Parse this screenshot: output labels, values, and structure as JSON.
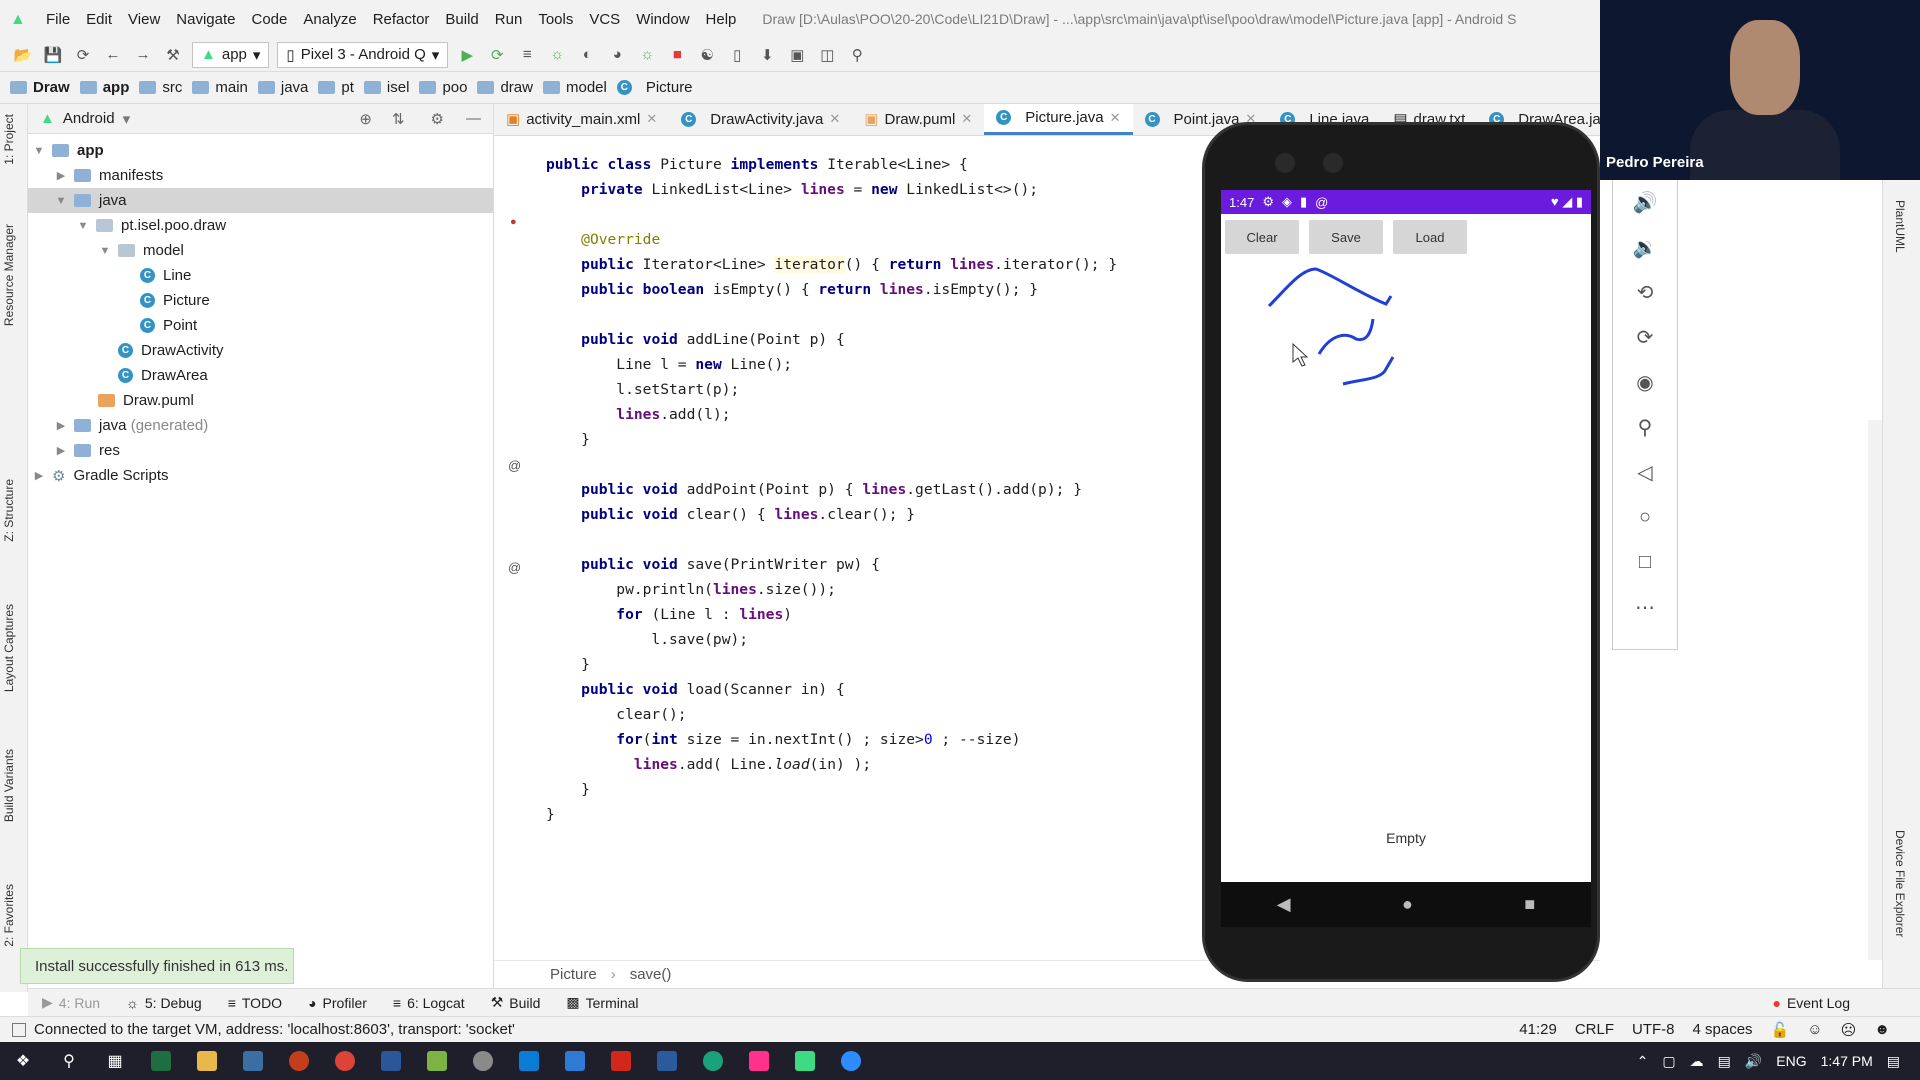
{
  "menu": {
    "items": [
      "File",
      "Edit",
      "View",
      "Navigate",
      "Code",
      "Analyze",
      "Refactor",
      "Build",
      "Run",
      "Tools",
      "VCS",
      "Window",
      "Help"
    ],
    "title": "Draw [D:\\Aulas\\POO\\20-20\\Code\\LI21D\\Draw] - ...\\app\\src\\main\\java\\pt\\isel\\poo\\draw\\model\\Picture.java [app] - Android S"
  },
  "toolbar": {
    "module": "app",
    "device": "Pixel 3 - Android Q"
  },
  "breadcrumbs": [
    "Draw",
    "app",
    "src",
    "main",
    "java",
    "pt",
    "isel",
    "poo",
    "draw",
    "model",
    "Picture"
  ],
  "left_strip": {
    "project": "1: Project",
    "resource": "Resource Manager",
    "structure": "Z: Structure",
    "layout": "Layout Captures",
    "variants": "Build Variants",
    "favorites": "2: Favorites"
  },
  "project": {
    "view": "Android",
    "tree": [
      {
        "label": "app",
        "depth": 0,
        "kind": "module"
      },
      {
        "label": "manifests",
        "depth": 1,
        "kind": "folder"
      },
      {
        "label": "java",
        "depth": 1,
        "kind": "folder",
        "selected": true
      },
      {
        "label": "pt.isel.poo.draw",
        "depth": 2,
        "kind": "package"
      },
      {
        "label": "model",
        "depth": 3,
        "kind": "package"
      },
      {
        "label": "Line",
        "depth": 4,
        "kind": "class"
      },
      {
        "label": "Picture",
        "depth": 4,
        "kind": "class"
      },
      {
        "label": "Point",
        "depth": 4,
        "kind": "class"
      },
      {
        "label": "DrawActivity",
        "depth": 3,
        "kind": "class"
      },
      {
        "label": "DrawArea",
        "depth": 3,
        "kind": "class"
      },
      {
        "label": "Draw.puml",
        "depth": 2,
        "kind": "file"
      },
      {
        "label": "java",
        "suffix": "(generated)",
        "depth": 1,
        "kind": "folder"
      },
      {
        "label": "res",
        "depth": 1,
        "kind": "folder"
      },
      {
        "label": "Gradle Scripts",
        "depth": 0,
        "kind": "gradle"
      }
    ]
  },
  "tabs": [
    "activity_main.xml",
    "DrawActivity.java",
    "Draw.puml",
    "Picture.java",
    "Point.java",
    "Line.java",
    "draw.txt",
    "DrawArea.java"
  ],
  "active_tab": "Picture.java",
  "code_breadcrumb": [
    "Picture",
    "save()"
  ],
  "emulator": {
    "time": "1:47",
    "buttons": [
      "Clear",
      "Save",
      "Load"
    ],
    "status_text": "Empty"
  },
  "webcam": {
    "name": "Pedro Pereira"
  },
  "right_strip": {
    "plantuml": "PlantUML",
    "device_explorer": "Device File Explorer"
  },
  "toast": "Install successfully finished in 613 ms.",
  "bottom_tabs": [
    "4: Run",
    "5: Debug",
    "TODO",
    "Profiler",
    "6: Logcat",
    "Build",
    "Terminal"
  ],
  "event_log": "Event Log",
  "status": {
    "message": "Connected to the target VM, address: 'localhost:8603', transport: 'socket'",
    "position": "41:29",
    "line_sep": "CRLF",
    "encoding": "UTF-8",
    "indent": "4 spaces"
  },
  "taskbar": {
    "lang": "ENG",
    "time": "1:47 PM"
  }
}
